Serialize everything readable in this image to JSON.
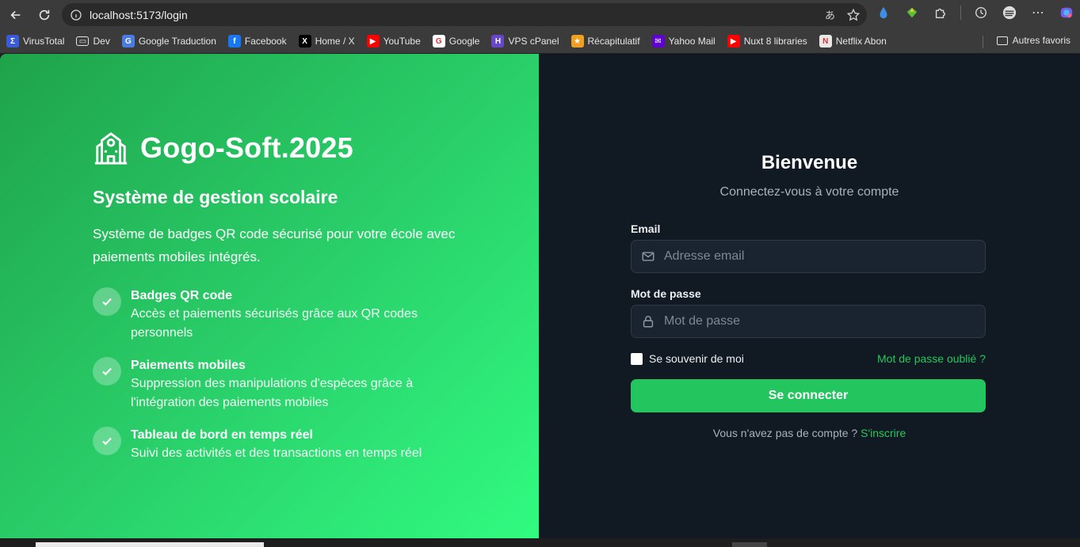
{
  "browser": {
    "url": "localhost:5173/login",
    "omnibox_icons": [
      "translate-icon",
      "star-icon"
    ],
    "extension_icons": [
      "drop-icon",
      "gem-icon",
      "puzzle-icon",
      "history-icon",
      "profile-icon",
      "more-icon",
      "copilot-icon"
    ],
    "bookmarks": [
      {
        "label": "VirusTotal",
        "icon": "virustotal-icon",
        "color": "#3a5cd8",
        "glyph": "Σ"
      },
      {
        "label": "Dev",
        "icon": "folder-icon",
        "color": "transparent",
        "glyph": "▭"
      },
      {
        "label": "Google Traduction",
        "icon": "translate-icon",
        "color": "#4a7be0",
        "glyph": "G"
      },
      {
        "label": "Facebook",
        "icon": "facebook-icon",
        "color": "#1877f2",
        "glyph": "f"
      },
      {
        "label": "Home / X",
        "icon": "x-icon",
        "color": "#000000",
        "glyph": "X"
      },
      {
        "label": "YouTube",
        "icon": "youtube-icon",
        "color": "#ff0000",
        "glyph": "▶"
      },
      {
        "label": "Google",
        "icon": "google-icon",
        "color": "#ffffff",
        "glyph": "G"
      },
      {
        "label": "VPS cPanel",
        "icon": "hostinger-icon",
        "color": "#6747c7",
        "glyph": "H"
      },
      {
        "label": "Récapitulatif",
        "icon": "star-badge-icon",
        "color": "#f0a020",
        "glyph": "★"
      },
      {
        "label": "Yahoo Mail",
        "icon": "yahoo-mail-icon",
        "color": "#6001d2",
        "glyph": "✉"
      },
      {
        "label": "Nuxt 8 libraries",
        "icon": "youtube-icon",
        "color": "#ff0000",
        "glyph": "▶"
      },
      {
        "label": "Netflix Abon",
        "icon": "netflix-icon",
        "color": "#e8e8e8",
        "glyph": "N"
      }
    ],
    "other_favorites": "Autres favoris"
  },
  "brand": {
    "icon": "school-building-icon",
    "name": "Gogo-Soft.2025",
    "subtitle": "Système de gestion scolaire",
    "intro": "Système de badges QR code sécurisé pour votre école avec paiements mobiles intégrés."
  },
  "features": [
    {
      "title": "Badges QR code",
      "desc": "Accès et paiements sécurisés grâce aux QR codes personnels"
    },
    {
      "title": "Paiements mobiles",
      "desc": "Suppression des manipulations d'espèces grâce à l'intégration des paiements mobiles"
    },
    {
      "title": "Tableau de bord en temps réel",
      "desc": "Suivi des activités et des transactions en temps réel"
    }
  ],
  "login": {
    "title": "Bienvenue",
    "subtitle": "Connectez-vous à votre compte",
    "email_label": "Email",
    "email_placeholder": "Adresse email",
    "password_label": "Mot de passe",
    "password_placeholder": "Mot de passe",
    "remember_label": "Se souvenir de moi",
    "forgot_label": "Mot de passe oublié ?",
    "submit_label": "Se connecter",
    "signup_prompt": "Vous n'avez pas de compte ?",
    "signup_link": "S'inscrire"
  },
  "colors": {
    "accent": "#22c55e",
    "panel_dark": "#111922",
    "gradient_start": "#1fa34b",
    "gradient_end": "#30fb80"
  }
}
